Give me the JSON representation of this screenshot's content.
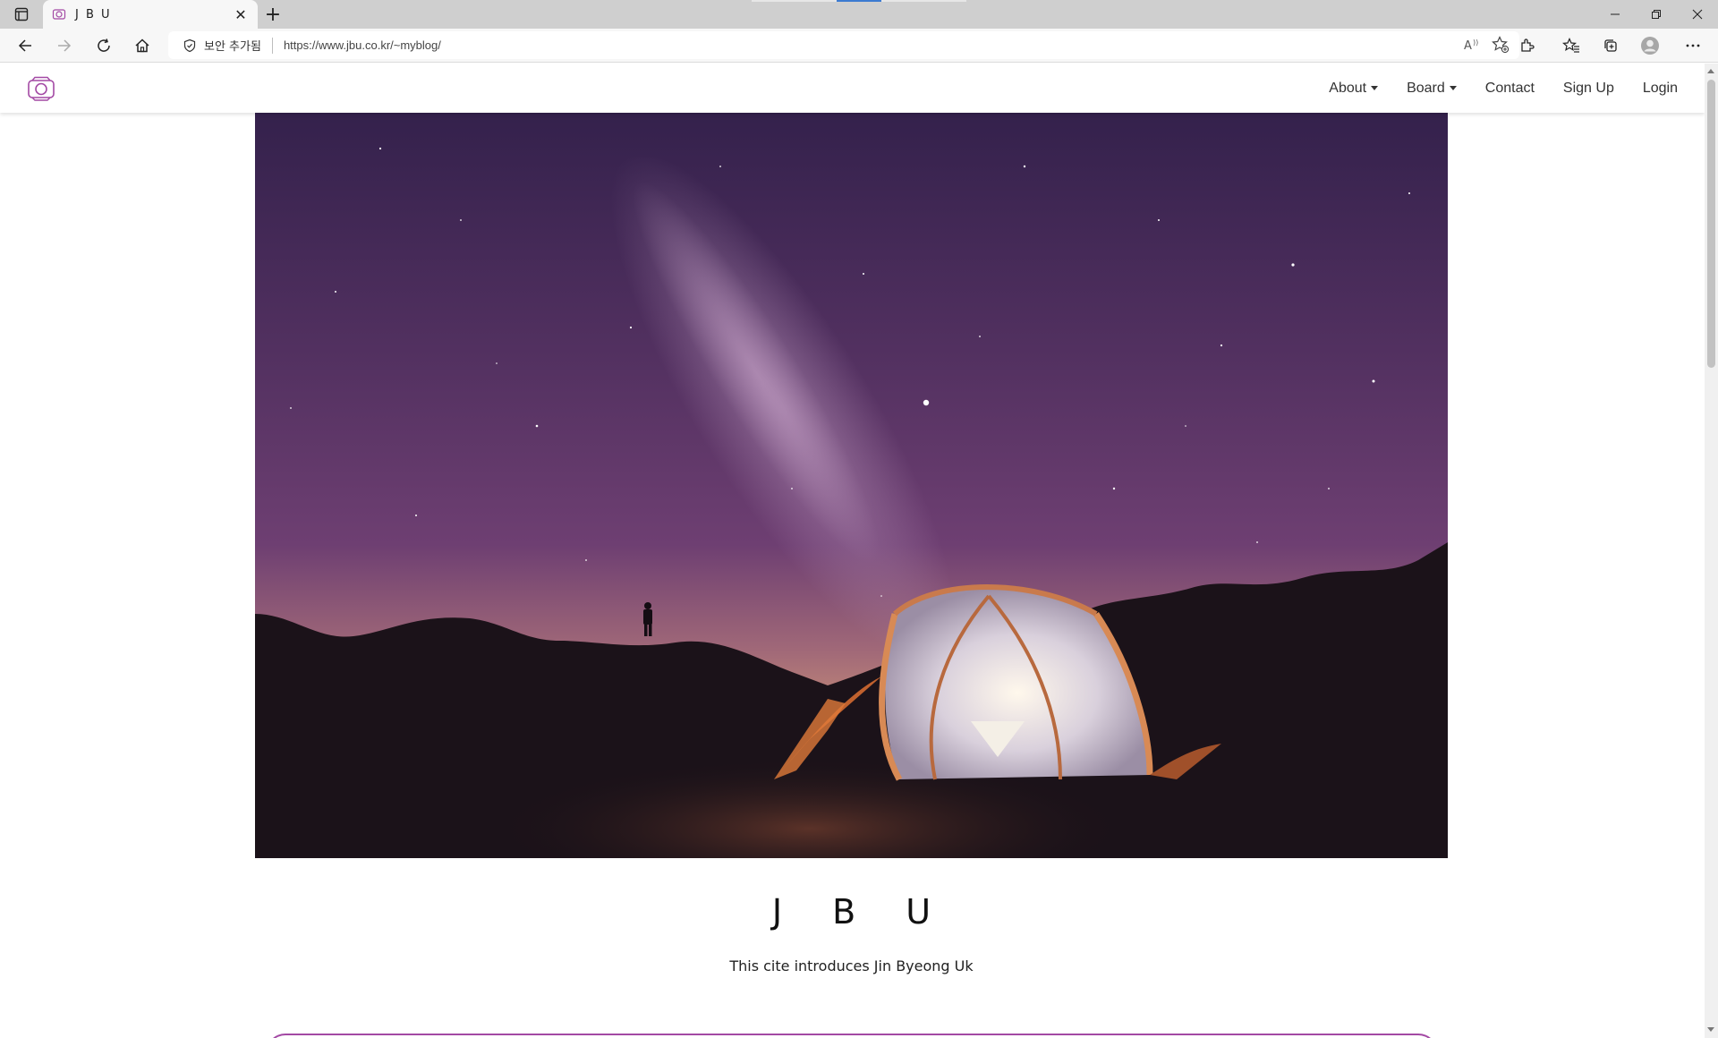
{
  "browser": {
    "tab": {
      "title": "J B U",
      "close_glyph": "✕"
    },
    "new_tab_glyph": "+",
    "address": {
      "security_label": "보안 추가됨",
      "url": "https://www.jbu.co.kr/~myblog/"
    },
    "icons": [
      "tab-actions-icon",
      "back-icon",
      "forward-icon",
      "refresh-icon",
      "home-icon",
      "shield-icon",
      "read-aloud-icon",
      "favorite-add-icon",
      "extensions-icon",
      "favorites-icon",
      "collections-icon",
      "profile-icon",
      "more-icon",
      "minimize-icon",
      "restore-icon",
      "close-window-icon"
    ]
  },
  "site": {
    "nav": {
      "items": [
        {
          "label": "About",
          "dropdown": true
        },
        {
          "label": "Board",
          "dropdown": true
        },
        {
          "label": "Contact",
          "dropdown": false
        },
        {
          "label": "Sign Up",
          "dropdown": false
        },
        {
          "label": "Login",
          "dropdown": false
        }
      ]
    },
    "brand_title": "J B U",
    "brand_subtitle": "This cite introduces Jin Byeong Uk"
  },
  "colors": {
    "accent": "#a349a4",
    "sky_top": "#3a2550",
    "sky_mid": "#6a3e74",
    "sky_horizon": "#b87a7a",
    "ground": "#1a1218"
  }
}
